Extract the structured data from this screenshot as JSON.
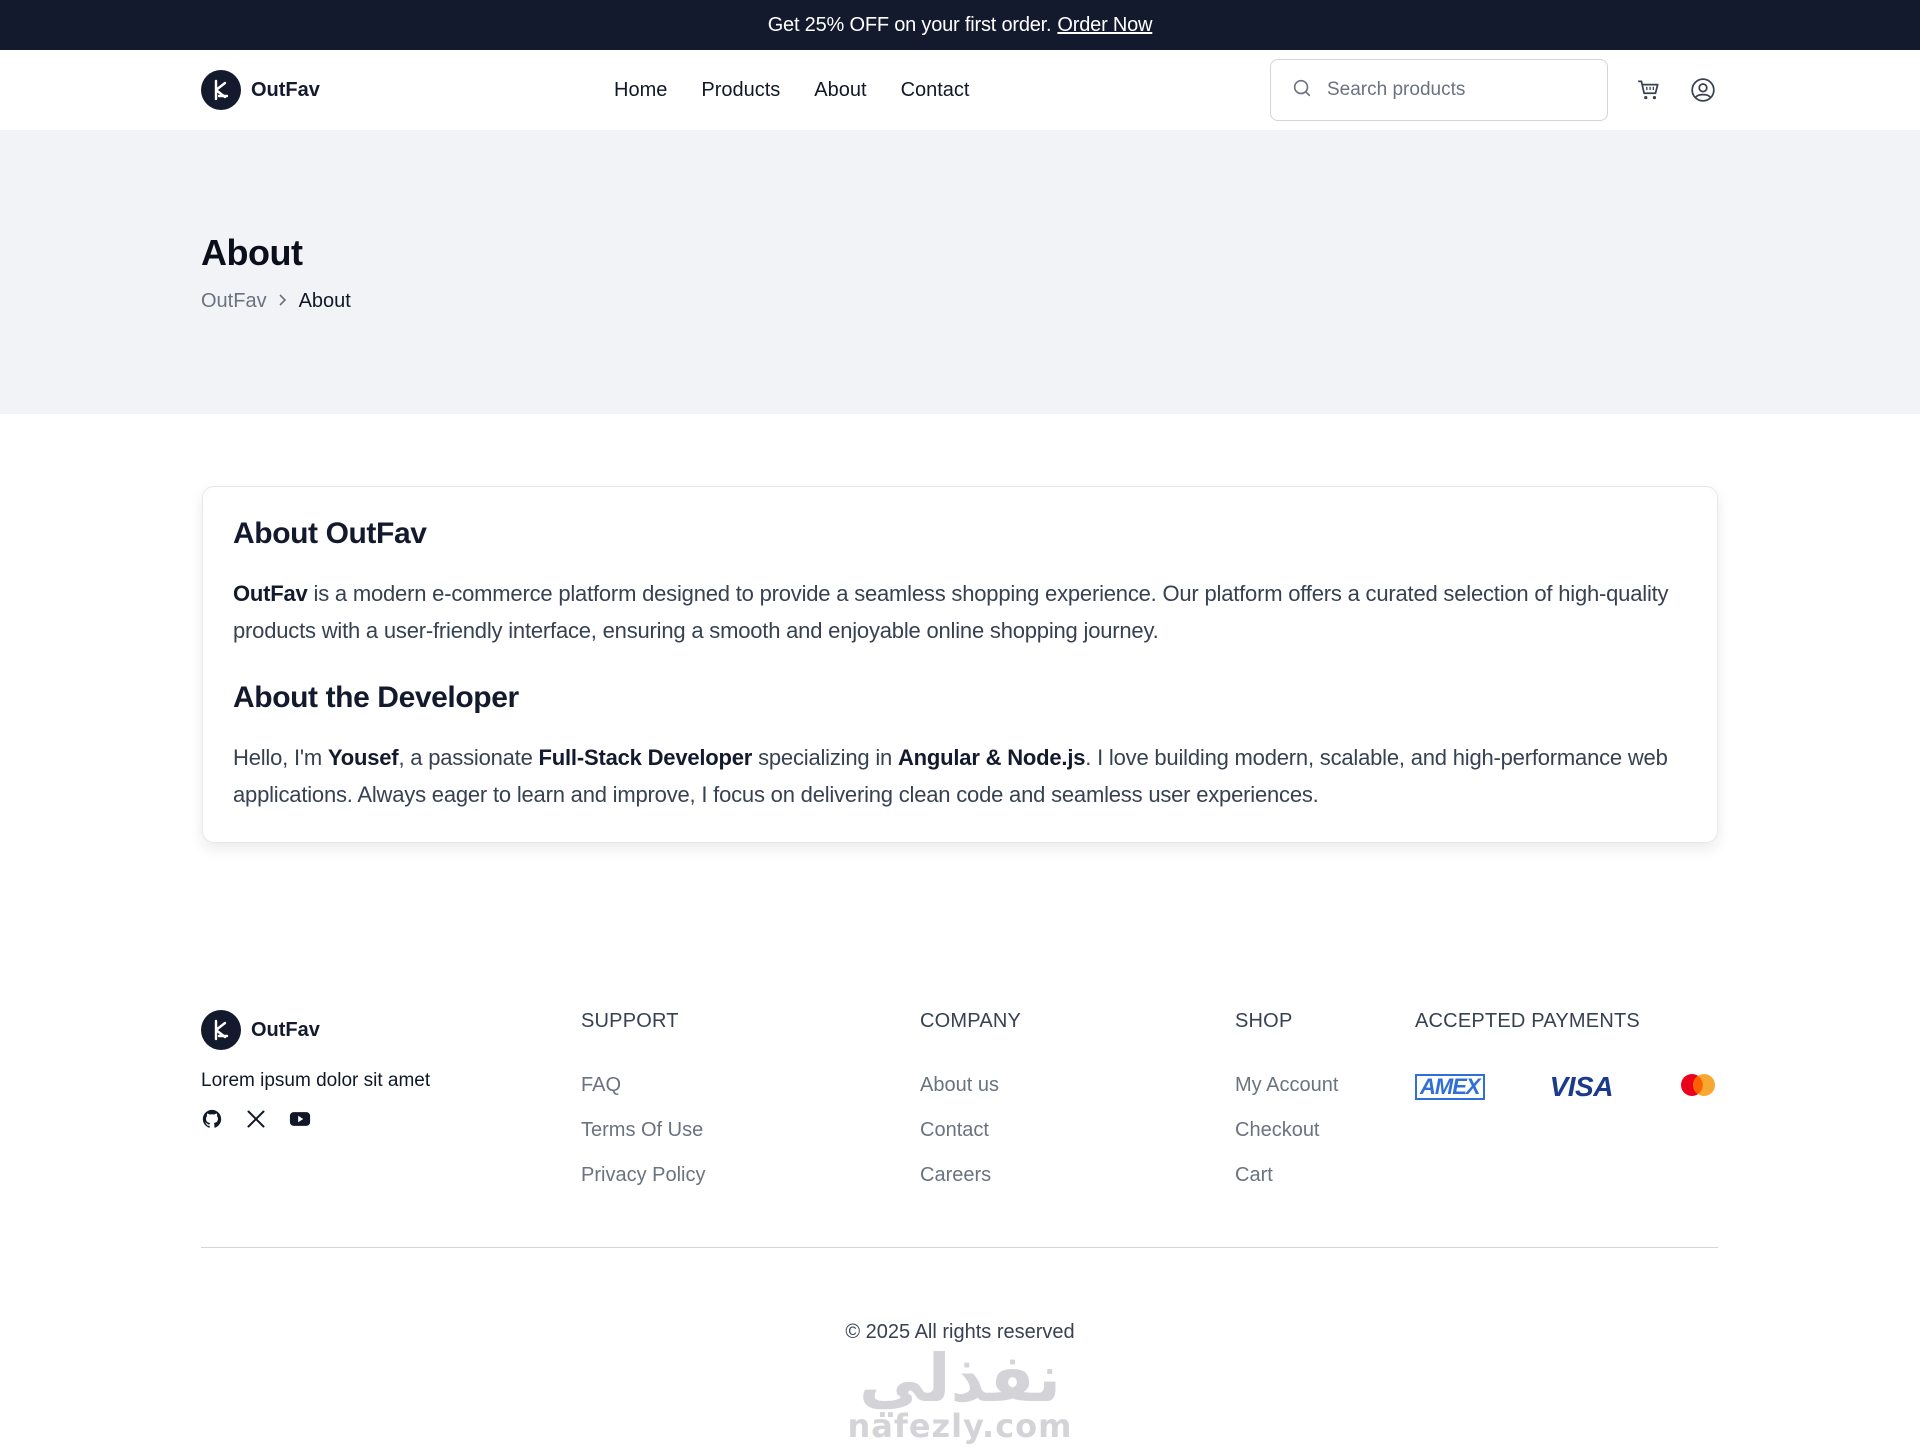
{
  "announcement": {
    "text": "Get 25% OFF on your first order.",
    "link": "Order Now"
  },
  "brand": {
    "name": "OutFav",
    "color": "#141a2e"
  },
  "nav": {
    "items": [
      "Home",
      "Products",
      "About",
      "Contact"
    ]
  },
  "search": {
    "placeholder": "Search products"
  },
  "header_icons": [
    "cart-icon",
    "user-icon"
  ],
  "hero": {
    "title": "About",
    "breadcrumb": [
      "OutFav",
      "About"
    ]
  },
  "about": {
    "heading": "About OutFav",
    "p1_strong": "OutFav",
    "p1_rest": " is a modern e-commerce platform designed to provide a seamless shopping experience. Our platform offers a curated selection of high-quality products with a user-friendly interface, ensuring a smooth and enjoyable online shopping journey.",
    "dev_heading": "About the Developer",
    "p2_a": "Hello, I'm ",
    "p2_name": "Yousef",
    "p2_b": ", a passionate ",
    "p2_role": "Full-Stack Developer",
    "p2_c": " specializing in ",
    "p2_stack": "Angular & Node.js",
    "p2_d": ". I love building modern, scalable, and high-performance web applications. Always eager to learn and improve, I focus on delivering clean code and seamless user experiences."
  },
  "footer": {
    "brand": "OutFav",
    "tagline": "Lorem ipsum dolor sit amet",
    "socials": [
      "github-icon",
      "x-icon",
      "youtube-icon"
    ],
    "support": {
      "title": "SUPPORT",
      "links": [
        "FAQ",
        "Terms Of Use",
        "Privacy Policy"
      ]
    },
    "company": {
      "title": "COMPANY",
      "links": [
        "About us",
        "Contact",
        "Careers"
      ]
    },
    "shop": {
      "title": "SHOP",
      "links": [
        "My Account",
        "Checkout",
        "Cart"
      ]
    },
    "payments": {
      "title": "ACCEPTED PAYMENTS",
      "methods": [
        "AMEX",
        "VISA"
      ],
      "icons": [
        "amex-icon",
        "visa-icon",
        "mastercard-icon"
      ]
    },
    "copyright": "© 2025 All rights reserved"
  },
  "watermark": {
    "arabic": "نفذلي",
    "latin": "nafezly.com"
  }
}
